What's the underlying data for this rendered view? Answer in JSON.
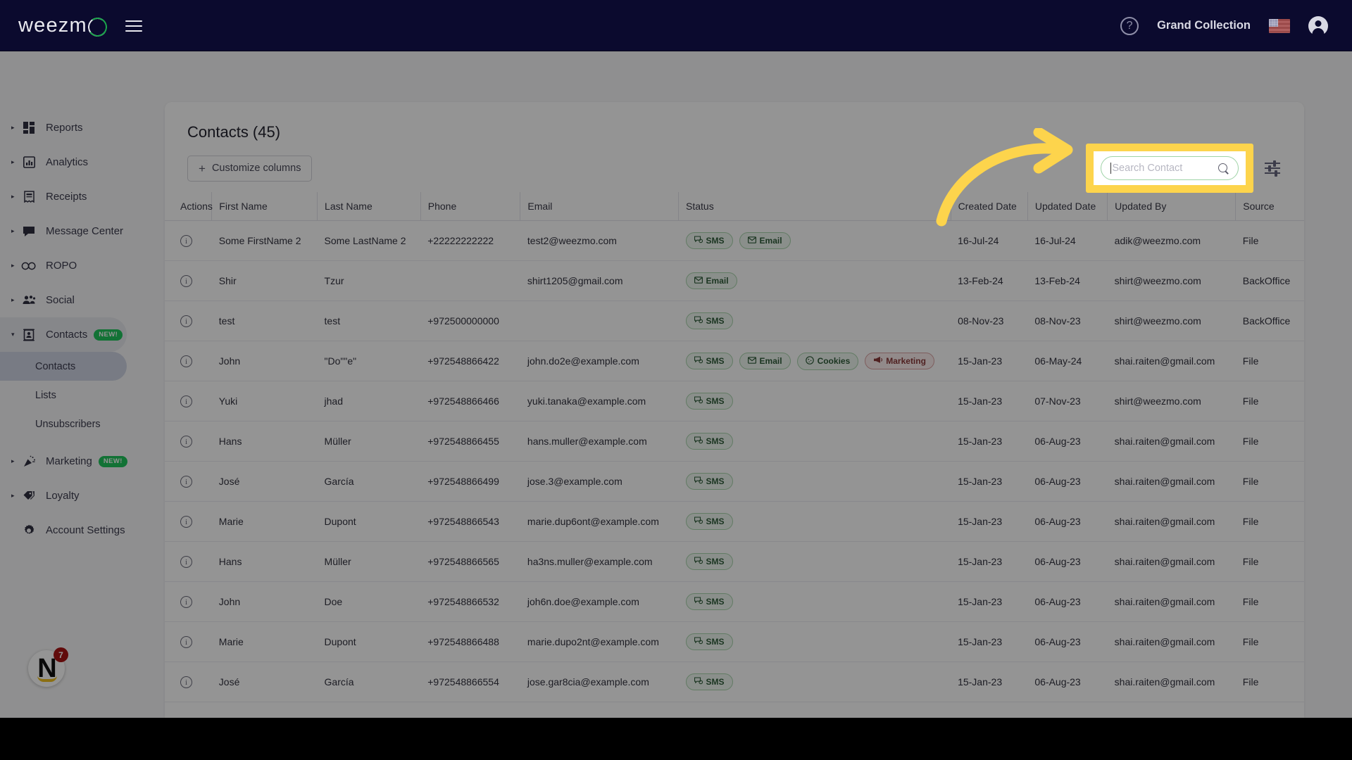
{
  "topbar": {
    "logo_text": "weezm",
    "logo_icon": "weezmo-logo",
    "menu_icon": "hamburger-menu-icon",
    "help_icon": "help-circle-icon",
    "help_glyph": "?",
    "account_name": "Grand Collection",
    "flag_icon": "us-flag-icon",
    "avatar_icon": "account-avatar-icon"
  },
  "sidebar": {
    "items": [
      {
        "label": "Reports",
        "icon": "dashboard-grid-icon",
        "expandable": true
      },
      {
        "label": "Analytics",
        "icon": "bar-chart-icon",
        "expandable": true
      },
      {
        "label": "Receipts",
        "icon": "receipt-icon",
        "expandable": true
      },
      {
        "label": "Message Center",
        "icon": "chat-bubble-icon",
        "expandable": true
      },
      {
        "label": "ROPO",
        "icon": "infinity-icon",
        "expandable": true
      },
      {
        "label": "Social",
        "icon": "people-group-icon",
        "expandable": true
      },
      {
        "label": "Contacts",
        "icon": "contact-card-icon",
        "expandable": true,
        "badge": "NEW!",
        "expanded": true
      },
      {
        "label": "Marketing",
        "icon": "megaphone-confetti-icon",
        "expandable": true,
        "badge": "NEW!"
      },
      {
        "label": "Loyalty",
        "icon": "tag-icon",
        "expandable": true
      },
      {
        "label": "Account Settings",
        "icon": "gear-icon",
        "expandable": false
      }
    ],
    "contacts_subitems": [
      {
        "label": "Contacts",
        "selected": true
      },
      {
        "label": "Lists",
        "selected": false
      },
      {
        "label": "Unsubscribers",
        "selected": false
      }
    ],
    "widget": {
      "letter": "N",
      "badge_count": "7",
      "name": "notifications-widget"
    }
  },
  "main": {
    "page_title": "Contacts (45)",
    "customize_columns_label": "Customize columns",
    "customize_columns_icon": "plus-icon",
    "search": {
      "placeholder": "Search Contact",
      "value": "",
      "icon": "search-icon",
      "highlighted": true,
      "highlight_color": "#fdd44c"
    },
    "filter_icon": "filter-sliders-icon",
    "columns": [
      "Actions",
      "First Name",
      "Last Name",
      "Phone",
      "Email",
      "Status",
      "Created Date",
      "Updated Date",
      "Updated By",
      "Source"
    ],
    "rows": [
      {
        "actions_icon": "info-circle-icon",
        "first_name": "Some FirstName 2",
        "last_name": "Some LastName 2",
        "phone": "+22222222222",
        "email": "test2@weezmo.com",
        "status": [
          {
            "label": "SMS",
            "tone": "green",
            "icon": "sms-icon"
          },
          {
            "label": "Email",
            "tone": "green",
            "icon": "envelope-icon"
          }
        ],
        "created_date": "16-Jul-24",
        "updated_date": "16-Jul-24",
        "updated_by": "adik@weezmo.com",
        "source": "File"
      },
      {
        "actions_icon": "info-circle-icon",
        "first_name": "Shir",
        "last_name": "Tzur",
        "phone": "",
        "email": "shirt1205@gmail.com",
        "status": [
          {
            "label": "Email",
            "tone": "green",
            "icon": "envelope-icon"
          }
        ],
        "created_date": "13-Feb-24",
        "updated_date": "13-Feb-24",
        "updated_by": "shirt@weezmo.com",
        "source": "BackOffice"
      },
      {
        "actions_icon": "info-circle-icon",
        "first_name": "test",
        "last_name": "test",
        "phone": "+972500000000",
        "email": "",
        "status": [
          {
            "label": "SMS",
            "tone": "green",
            "icon": "sms-icon"
          }
        ],
        "created_date": "08-Nov-23",
        "updated_date": "08-Nov-23",
        "updated_by": "shirt@weezmo.com",
        "source": "BackOffice"
      },
      {
        "actions_icon": "info-circle-icon",
        "first_name": "John",
        "last_name": "\"Do\"\"e\"",
        "phone": "+972548866422",
        "email": "john.do2e@example.com",
        "status": [
          {
            "label": "SMS",
            "tone": "green",
            "icon": "sms-icon"
          },
          {
            "label": "Email",
            "tone": "green",
            "icon": "envelope-icon"
          },
          {
            "label": "Cookies",
            "tone": "green",
            "icon": "cookie-icon"
          },
          {
            "label": "Marketing",
            "tone": "red",
            "icon": "megaphone-icon"
          }
        ],
        "created_date": "15-Jan-23",
        "updated_date": "06-May-24",
        "updated_by": "shai.raiten@gmail.com",
        "source": "File"
      },
      {
        "actions_icon": "info-circle-icon",
        "first_name": "Yuki",
        "last_name": "jhad",
        "phone": "+972548866466",
        "email": "yuki.tanaka@example.com",
        "status": [
          {
            "label": "SMS",
            "tone": "green",
            "icon": "sms-icon"
          }
        ],
        "created_date": "15-Jan-23",
        "updated_date": "07-Nov-23",
        "updated_by": "shirt@weezmo.com",
        "source": "File"
      },
      {
        "actions_icon": "info-circle-icon",
        "first_name": "Hans",
        "last_name": "Müller",
        "phone": "+972548866455",
        "email": "hans.muller@example.com",
        "status": [
          {
            "label": "SMS",
            "tone": "green",
            "icon": "sms-icon"
          }
        ],
        "created_date": "15-Jan-23",
        "updated_date": "06-Aug-23",
        "updated_by": "shai.raiten@gmail.com",
        "source": "File"
      },
      {
        "actions_icon": "info-circle-icon",
        "first_name": "José",
        "last_name": "García",
        "phone": "+972548866499",
        "email": "jose.3@example.com",
        "status": [
          {
            "label": "SMS",
            "tone": "green",
            "icon": "sms-icon"
          }
        ],
        "created_date": "15-Jan-23",
        "updated_date": "06-Aug-23",
        "updated_by": "shai.raiten@gmail.com",
        "source": "File"
      },
      {
        "actions_icon": "info-circle-icon",
        "first_name": "Marie",
        "last_name": "Dupont",
        "phone": "+972548866543",
        "email": "marie.dup6ont@example.com",
        "status": [
          {
            "label": "SMS",
            "tone": "green",
            "icon": "sms-icon"
          }
        ],
        "created_date": "15-Jan-23",
        "updated_date": "06-Aug-23",
        "updated_by": "shai.raiten@gmail.com",
        "source": "File"
      },
      {
        "actions_icon": "info-circle-icon",
        "first_name": "Hans",
        "last_name": "Müller",
        "phone": "+972548866565",
        "email": "ha3ns.muller@example.com",
        "status": [
          {
            "label": "SMS",
            "tone": "green",
            "icon": "sms-icon"
          }
        ],
        "created_date": "15-Jan-23",
        "updated_date": "06-Aug-23",
        "updated_by": "shai.raiten@gmail.com",
        "source": "File"
      },
      {
        "actions_icon": "info-circle-icon",
        "first_name": "John",
        "last_name": "Doe",
        "phone": "+972548866532",
        "email": "joh6n.doe@example.com",
        "status": [
          {
            "label": "SMS",
            "tone": "green",
            "icon": "sms-icon"
          }
        ],
        "created_date": "15-Jan-23",
        "updated_date": "06-Aug-23",
        "updated_by": "shai.raiten@gmail.com",
        "source": "File"
      },
      {
        "actions_icon": "info-circle-icon",
        "first_name": "Marie",
        "last_name": "Dupont",
        "phone": "+972548866488",
        "email": "marie.dupo2nt@example.com",
        "status": [
          {
            "label": "SMS",
            "tone": "green",
            "icon": "sms-icon"
          }
        ],
        "created_date": "15-Jan-23",
        "updated_date": "06-Aug-23",
        "updated_by": "shai.raiten@gmail.com",
        "source": "File"
      },
      {
        "actions_icon": "info-circle-icon",
        "first_name": "José",
        "last_name": "García",
        "phone": "+972548866554",
        "email": "jose.gar8cia@example.com",
        "status": [
          {
            "label": "SMS",
            "tone": "green",
            "icon": "sms-icon"
          }
        ],
        "created_date": "15-Jan-23",
        "updated_date": "06-Aug-23",
        "updated_by": "shai.raiten@gmail.com",
        "source": "File"
      }
    ]
  },
  "annotations": {
    "arrow": {
      "name": "pointer-arrow-annotation",
      "color": "#fdd44c",
      "points_to": "search-input"
    }
  }
}
